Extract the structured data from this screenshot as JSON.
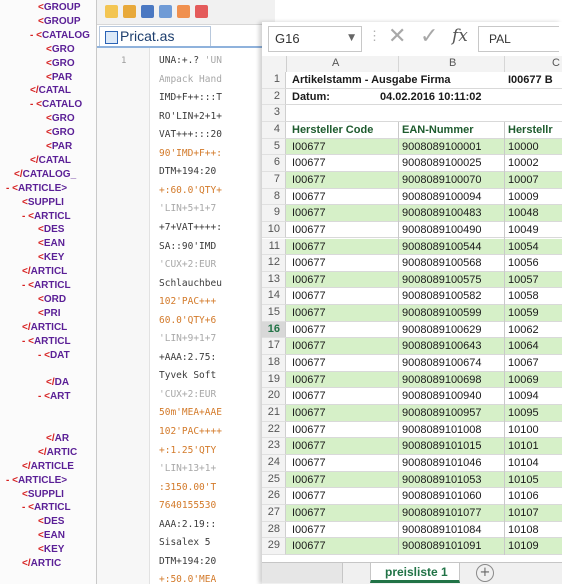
{
  "xml_tree": [
    {
      "m": "<",
      "t": "GROUP"
    },
    {
      "m": "<",
      "t": "GROUP"
    },
    {
      "m": "- <",
      "t": "CATALOG"
    },
    {
      "m": "<",
      "t": "GRO"
    },
    {
      "m": "<",
      "t": "GRO"
    },
    {
      "m": "<",
      "t": "PAR"
    },
    {
      "m": "</",
      "t": "CATAL"
    },
    {
      "m": "- <",
      "t": "CATALO"
    },
    {
      "m": "<",
      "t": "GRO"
    },
    {
      "m": "<",
      "t": "GRO"
    },
    {
      "m": "<",
      "t": "PAR"
    },
    {
      "m": "</",
      "t": "CATAL"
    },
    {
      "m": "</",
      "t": "CATALOG_"
    },
    {
      "m": "- <",
      "t": "ARTICLE>"
    },
    {
      "m": "<",
      "t": "SUPPLI"
    },
    {
      "m": "- <",
      "t": "ARTICL"
    },
    {
      "m": "<",
      "t": "DES"
    },
    {
      "m": "<",
      "t": "EAN"
    },
    {
      "m": "<",
      "t": "KEY"
    },
    {
      "m": "</",
      "t": "ARTICL"
    },
    {
      "m": "- <",
      "t": "ARTICL"
    },
    {
      "m": "<",
      "t": "ORD"
    },
    {
      "m": "<",
      "t": "PRI"
    },
    {
      "m": "</",
      "t": "ARTICL"
    },
    {
      "m": "- <",
      "t": "ARTICL"
    },
    {
      "m": "- <",
      "t": "DAT"
    },
    {
      "m": "",
      "t": ""
    },
    {
      "m": "</",
      "t": "DA"
    },
    {
      "m": "- <",
      "t": "ART"
    },
    {
      "m": "",
      "t": ""
    },
    {
      "m": "",
      "t": ""
    },
    {
      "m": "</",
      "t": "AR"
    },
    {
      "m": "</",
      "t": "ARTIC"
    },
    {
      "m": "</",
      "t": "ARTICLE"
    },
    {
      "m": "- <",
      "t": "ARTICLE>"
    },
    {
      "m": "<",
      "t": "SUPPLI"
    },
    {
      "m": "- <",
      "t": "ARTICL"
    },
    {
      "m": "<",
      "t": "DES"
    },
    {
      "m": "<",
      "t": "EAN"
    },
    {
      "m": "<",
      "t": "KEY"
    },
    {
      "m": "</",
      "t": "ARTIC"
    }
  ],
  "editor": {
    "tab_label": "Pricat.as",
    "line_number": "1",
    "lines": [
      {
        "k": "UNA:+.?",
        "r": "",
        "g": " 'UN"
      },
      {
        "k": "",
        "r": "",
        "g": "Ampack Hand"
      },
      {
        "k": "IMD+F++:::T",
        "r": "",
        "g": ""
      },
      {
        "k": "RO'LIN+2+1+",
        "r": "",
        "g": ""
      },
      {
        "k": "VAT+++:::20",
        "r": "",
        "g": ""
      },
      {
        "k": "",
        "r": "90'IMD+F++:",
        "g": ""
      },
      {
        "k": "DTM+194:20",
        "r": "",
        "g": ""
      },
      {
        "k": "",
        "r": "+:60.0'QTY+",
        "g": ""
      },
      {
        "k": "",
        "r": "",
        "g": "'LIN+5+1+7"
      },
      {
        "k": "+7+VAT++++:",
        "r": "",
        "g": ""
      },
      {
        "k": "SA::90'IMD",
        "r": "",
        "g": ""
      },
      {
        "k": "",
        "r": "",
        "g": "'CUX+2:EUR"
      },
      {
        "k": "Schlauchbeu",
        "r": "",
        "g": ""
      },
      {
        "k": "",
        "r": "102'PAC+++",
        "g": ""
      },
      {
        "k": "",
        "r": "60.0'QTY+6",
        "g": ""
      },
      {
        "k": "",
        "r": "",
        "g": "'LIN+9+1+7"
      },
      {
        "k": "+AAA:2.75:",
        "r": "",
        "g": ""
      },
      {
        "k": "Tyvek Soft",
        "r": "",
        "g": ""
      },
      {
        "k": "",
        "r": "",
        "g": "'CUX+2:EUR"
      },
      {
        "k": "",
        "r": "50m'MEA+AAE",
        "g": ""
      },
      {
        "k": "",
        "r": "102'PAC++++",
        "g": ""
      },
      {
        "k": "",
        "r": "+:1.25'QTY",
        "g": ""
      },
      {
        "k": "",
        "r": "",
        "g": "'LIN+13+1+"
      },
      {
        "k": "",
        "r": ":3150.00'T",
        "g": ""
      },
      {
        "k": "",
        "r": "7640155530",
        "g": ""
      },
      {
        "k": "AAA:2.19::",
        "r": "",
        "g": ""
      },
      {
        "k": "Sisalex 5",
        "r": "",
        "g": ""
      },
      {
        "k": "DTM+194:20",
        "r": "",
        "g": ""
      },
      {
        "k": "",
        "r": "+:50.0'MEA",
        "g": ""
      }
    ]
  },
  "spreadsheet": {
    "name_box": "G16",
    "formula_value": "PAL",
    "columns": [
      "A",
      "B",
      "C"
    ],
    "title_row": {
      "a": "Artikelstamm - Ausgabe Firma",
      "c": "I00677 B"
    },
    "date_label": "Datum:",
    "date_value": "04.02.2016 10:11:02",
    "header_row": [
      "Hersteller Code",
      "EAN-Nummer",
      "Herstellr"
    ],
    "row_numbers": [
      "1",
      "2",
      "3",
      "4",
      "5",
      "6",
      "7",
      "8",
      "9",
      "10",
      "11",
      "12",
      "13",
      "14",
      "15",
      "16",
      "17",
      "18",
      "19",
      "20",
      "21",
      "22",
      "23",
      "24",
      "25",
      "26",
      "27",
      "28",
      "29"
    ],
    "data_rows": [
      {
        "a": "I00677",
        "b": "9008089100001",
        "c": "10000"
      },
      {
        "a": "I00677",
        "b": "9008089100025",
        "c": "10002"
      },
      {
        "a": "I00677",
        "b": "9008089100070",
        "c": "10007"
      },
      {
        "a": "I00677",
        "b": "9008089100094",
        "c": "10009"
      },
      {
        "a": "I00677",
        "b": "9008089100483",
        "c": "10048"
      },
      {
        "a": "I00677",
        "b": "9008089100490",
        "c": "10049"
      },
      {
        "a": "I00677",
        "b": "9008089100544",
        "c": "10054"
      },
      {
        "a": "I00677",
        "b": "9008089100568",
        "c": "10056"
      },
      {
        "a": "I00677",
        "b": "9008089100575",
        "c": "10057"
      },
      {
        "a": "I00677",
        "b": "9008089100582",
        "c": "10058"
      },
      {
        "a": "I00677",
        "b": "9008089100599",
        "c": "10059"
      },
      {
        "a": "I00677",
        "b": "9008089100629",
        "c": "10062"
      },
      {
        "a": "I00677",
        "b": "9008089100643",
        "c": "10064"
      },
      {
        "a": "I00677",
        "b": "9008089100674",
        "c": "10067"
      },
      {
        "a": "I00677",
        "b": "9008089100698",
        "c": "10069"
      },
      {
        "a": "I00677",
        "b": "9008089100940",
        "c": "10094"
      },
      {
        "a": "I00677",
        "b": "9008089100957",
        "c": "10095"
      },
      {
        "a": "I00677",
        "b": "9008089101008",
        "c": "10100"
      },
      {
        "a": "I00677",
        "b": "9008089101015",
        "c": "10101"
      },
      {
        "a": "I00677",
        "b": "9008089101046",
        "c": "10104"
      },
      {
        "a": "I00677",
        "b": "9008089101053",
        "c": "10105"
      },
      {
        "a": "I00677",
        "b": "9008089101060",
        "c": "10106"
      },
      {
        "a": "I00677",
        "b": "9008089101077",
        "c": "10107"
      },
      {
        "a": "I00677",
        "b": "9008089101084",
        "c": "10108"
      },
      {
        "a": "I00677",
        "b": "9008089101091",
        "c": "10109"
      }
    ],
    "sheet_tab": "preisliste 1",
    "add_sheet": "+",
    "colors": {
      "green_row": "#d6f0c8",
      "accent": "#217346"
    }
  }
}
